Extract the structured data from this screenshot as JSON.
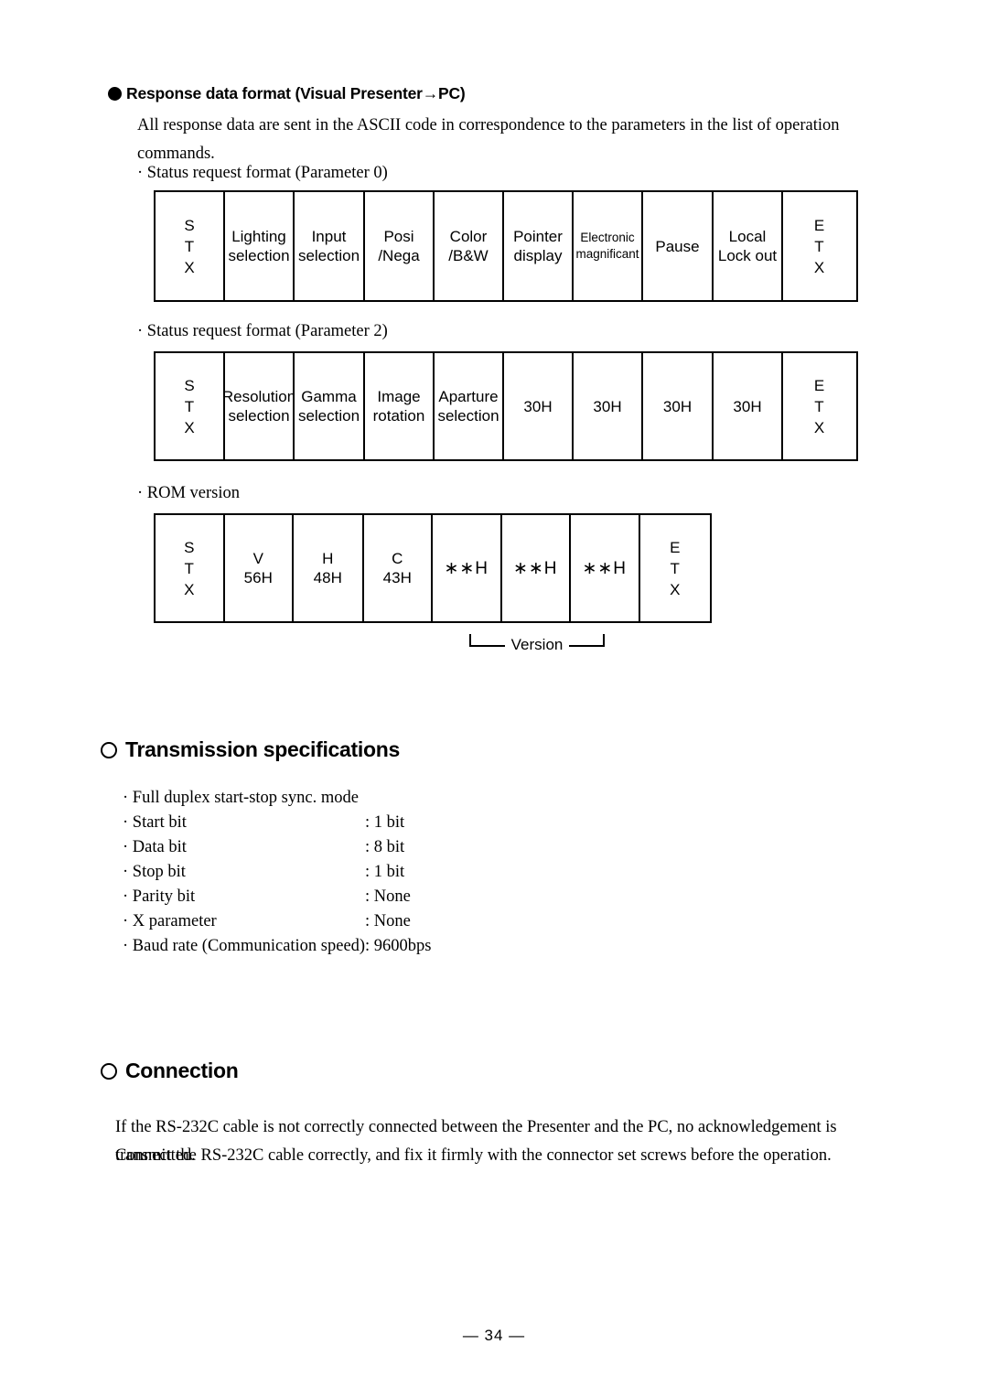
{
  "headings": {
    "response_format": "Response data format (Visual Presenter→PC)",
    "transmission": "Transmission specifications",
    "connection": "Connection"
  },
  "intro": {
    "paragraph": "All response data are sent in the ASCII code in correspondence to the parameters in the list of operation commands."
  },
  "captions": {
    "table1": "· Status request format (Parameter 0)",
    "table2": "· Status request format (Parameter 2)",
    "table3": "· ROM version"
  },
  "table1": {
    "cells": [
      {
        "lines": [
          "S",
          "T",
          "X"
        ],
        "style": "stacked"
      },
      {
        "lines": [
          "Lighting",
          "selection"
        ],
        "style": "normal"
      },
      {
        "lines": [
          "Input",
          "selection"
        ],
        "style": "normal"
      },
      {
        "lines": [
          "Posi",
          "/Nega"
        ],
        "style": "normal"
      },
      {
        "lines": [
          "Color",
          "/B&W"
        ],
        "style": "normal"
      },
      {
        "lines": [
          "Pointer",
          "display"
        ],
        "style": "normal"
      },
      {
        "lines": [
          "Electronic",
          "magnificant"
        ],
        "style": "small"
      },
      {
        "lines": [
          "Pause"
        ],
        "style": "normal"
      },
      {
        "lines": [
          "Local",
          "Lock out"
        ],
        "style": "normal"
      },
      {
        "lines": [
          "E",
          "T",
          "X"
        ],
        "style": "stacked"
      }
    ]
  },
  "table2": {
    "cells": [
      {
        "lines": [
          "S",
          "T",
          "X"
        ],
        "style": "stacked"
      },
      {
        "lines": [
          "Resolution",
          "selection"
        ],
        "style": "normal"
      },
      {
        "lines": [
          "Gamma",
          "selection"
        ],
        "style": "normal"
      },
      {
        "lines": [
          "Image",
          "rotation"
        ],
        "style": "normal"
      },
      {
        "lines": [
          "Aparture",
          "selection"
        ],
        "style": "normal"
      },
      {
        "lines": [
          "30H"
        ],
        "style": "normal"
      },
      {
        "lines": [
          "30H"
        ],
        "style": "normal"
      },
      {
        "lines": [
          "30H"
        ],
        "style": "normal"
      },
      {
        "lines": [
          "30H"
        ],
        "style": "normal"
      },
      {
        "lines": [
          "E",
          "T",
          "X"
        ],
        "style": "stacked"
      }
    ]
  },
  "table3": {
    "cells": [
      {
        "lines": [
          "S",
          "T",
          "X"
        ],
        "style": "stacked"
      },
      {
        "lines": [
          "V",
          "56H"
        ],
        "style": "normal"
      },
      {
        "lines": [
          "H",
          "48H"
        ],
        "style": "normal"
      },
      {
        "lines": [
          "C",
          "43H"
        ],
        "style": "normal"
      },
      {
        "lines": [
          "∗∗H"
        ],
        "style": "star"
      },
      {
        "lines": [
          "∗∗H"
        ],
        "style": "star"
      },
      {
        "lines": [
          "∗∗H"
        ],
        "style": "star"
      },
      {
        "lines": [
          "E",
          "T",
          "X"
        ],
        "style": "stacked"
      }
    ],
    "bracket_label": "Version"
  },
  "transmission_specs": {
    "mode_line": "· Full duplex start-stop sync. mode",
    "rows": [
      {
        "label": "· Start bit",
        "value": ": 1 bit"
      },
      {
        "label": "· Data bit",
        "value": ": 8 bit"
      },
      {
        "label": "· Stop bit",
        "value": ": 1 bit"
      },
      {
        "label": "· Parity bit",
        "value": ": None"
      },
      {
        "label": "· X parameter",
        "value": ": None"
      },
      {
        "label": "· Baud rate (Communication speed)",
        "value": ": 9600bps"
      }
    ]
  },
  "connection": {
    "line1": "If the RS-232C cable is not correctly connected between the Presenter and the PC, no acknowledgement is transmitted.",
    "line2": "Connect the RS-232C cable correctly, and fix it firmly with the connector set screws before the operation."
  },
  "footer": {
    "page_number": "— 34 —"
  }
}
